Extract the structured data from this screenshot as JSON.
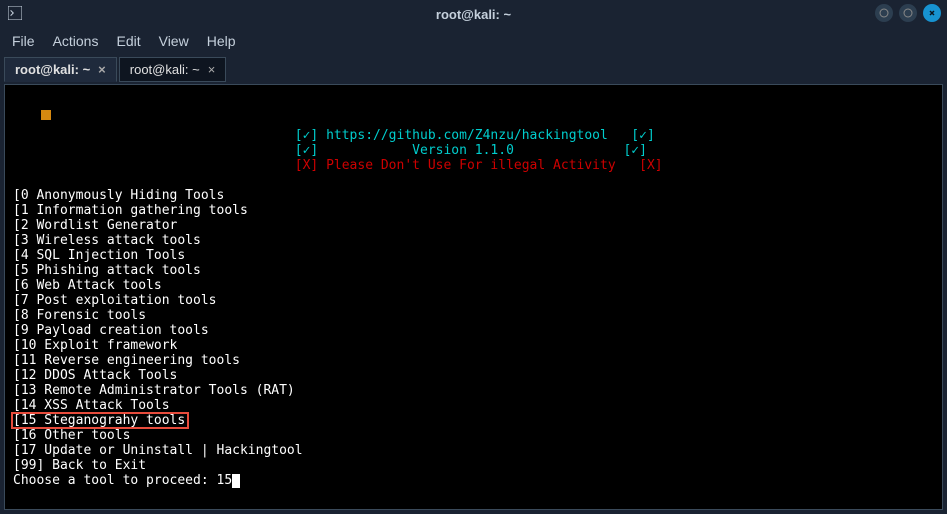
{
  "window": {
    "title": "root@kali: ~"
  },
  "menubar": {
    "file": "File",
    "actions": "Actions",
    "edit": "Edit",
    "view": "View",
    "help": "Help"
  },
  "tabs": [
    {
      "label": "root@kali: ~",
      "active": true
    },
    {
      "label": "root@kali: ~",
      "active": false
    }
  ],
  "terminal": {
    "header_lines": [
      {
        "prefix": "[✓] ",
        "text": "https://github.com/Z4nzu/hackingtool",
        "suffix": "   [✓]",
        "color": "cyan"
      },
      {
        "prefix": "[✓]            ",
        "text": "Version 1.1.0",
        "suffix": "              [✓]",
        "color": "cyan"
      },
      {
        "prefix": "[X] ",
        "text": "Please Don't Use For illegal Activity",
        "suffix": "   [X]",
        "color": "red"
      }
    ],
    "menu_items": [
      "[0 Anonymously Hiding Tools",
      "[1 Information gathering tools",
      "[2 Wordlist Generator",
      "[3 Wireless attack tools",
      "[4 SQL Injection Tools",
      "[5 Phishing attack tools",
      "[6 Web Attack tools",
      "[7 Post exploitation tools",
      "[8 Forensic tools",
      "[9 Payload creation tools",
      "[10 Exploit framework",
      "[11 Reverse engineering tools",
      "[12 DDOS Attack Tools",
      "[13 Remote Administrator Tools (RAT)",
      "[14 XSS Attack Tools",
      "[15 Steganograhy tools",
      "[16 Other tools",
      "[17 Update or Uninstall | Hackingtool",
      "[99] Back to Exit"
    ],
    "prompt": "Choose a tool to proceed: ",
    "input_value": "15"
  },
  "highlight_index": 15
}
